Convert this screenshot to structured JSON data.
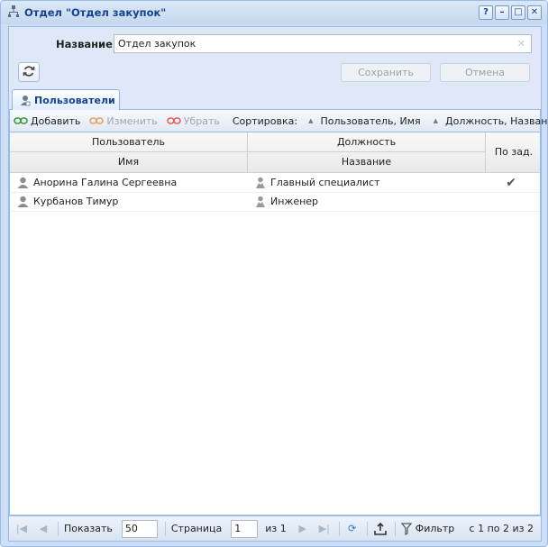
{
  "window": {
    "title": "Отдел \"Отдел закупок\"",
    "buttons": [
      "?",
      "–",
      "□",
      "✕"
    ]
  },
  "form": {
    "name_label": "Название:",
    "name_value": "Отдел закупок",
    "save_label": "Сохранить",
    "cancel_label": "Отмена"
  },
  "tab": {
    "label": "Пользователи"
  },
  "toolbar": {
    "add": "Добавить",
    "edit": "Изменить",
    "remove": "Убрать",
    "sort_label": "Сортировка:",
    "sort1": "Пользователь, Имя",
    "sort2": "Должность, Название"
  },
  "grid": {
    "headers": {
      "user": "Пользователь",
      "name": "Имя",
      "position": "Должность",
      "title": "Название",
      "default": "По зад."
    },
    "rows": [
      {
        "user": "Анорина Галина Сергеевна",
        "position": "Главный специалист",
        "default": "✔"
      },
      {
        "user": "Курбанов Тимур",
        "position": "Инженер",
        "default": ""
      }
    ]
  },
  "statusbar": {
    "show_label": "Показать",
    "page_size": "50",
    "page_label": "Страница",
    "page_value": "1",
    "of_pages": "из 1",
    "filter_label": "Фильтр",
    "range_text": "с 1 по 2 из 2"
  },
  "colors": {
    "accent": "#15428b",
    "border": "#99bbe8"
  }
}
